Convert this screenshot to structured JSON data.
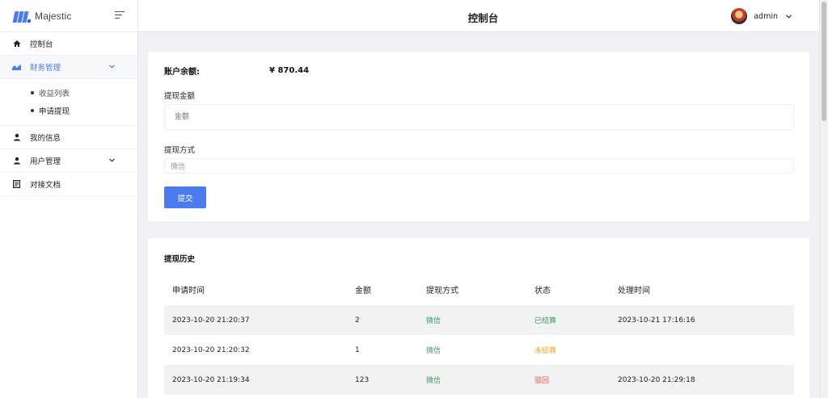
{
  "brand": {
    "name": "Majestic"
  },
  "header": {
    "title": "控制台",
    "user": "admin"
  },
  "sidebar": {
    "items": [
      {
        "label": "控制台",
        "icon": "home-icon"
      },
      {
        "label": "财务管理",
        "icon": "chart-icon"
      },
      {
        "label": "我的信息",
        "icon": "user-icon"
      },
      {
        "label": "用户管理",
        "icon": "user-icon"
      },
      {
        "label": "对接文档",
        "icon": "document-icon"
      }
    ],
    "finance_sub": [
      {
        "label": "收益列表"
      },
      {
        "label": "申请提现"
      }
    ]
  },
  "withdraw_form": {
    "balance_label": "账户余额:",
    "balance_value": "¥ 870.44",
    "amount_label": "提现金额",
    "amount_placeholder": "金额",
    "method_label": "提现方式",
    "method_value": "微信",
    "submit_label": "提交"
  },
  "history": {
    "title": "提现历史",
    "columns": [
      "申请时间",
      "金额",
      "提现方式",
      "状态",
      "处理时间"
    ],
    "rows": [
      {
        "time": "2023-10-20 21:20:37",
        "amount": "2",
        "method": "微信",
        "status": "已结算",
        "processed": "2023-10-21 17:16:16"
      },
      {
        "time": "2023-10-20 21:20:32",
        "amount": "1",
        "method": "微信",
        "status": "未结算",
        "processed": ""
      },
      {
        "time": "2023-10-20 21:19:34",
        "amount": "123",
        "method": "微信",
        "status": "驳回",
        "processed": "2023-10-20 21:29:18"
      }
    ]
  },
  "colors": {
    "accent": "#4a7cf0",
    "status_settled": "#3c9d5d",
    "status_pending": "#f5a623",
    "status_rejected": "#e25555",
    "method": "#3c9d5d"
  }
}
